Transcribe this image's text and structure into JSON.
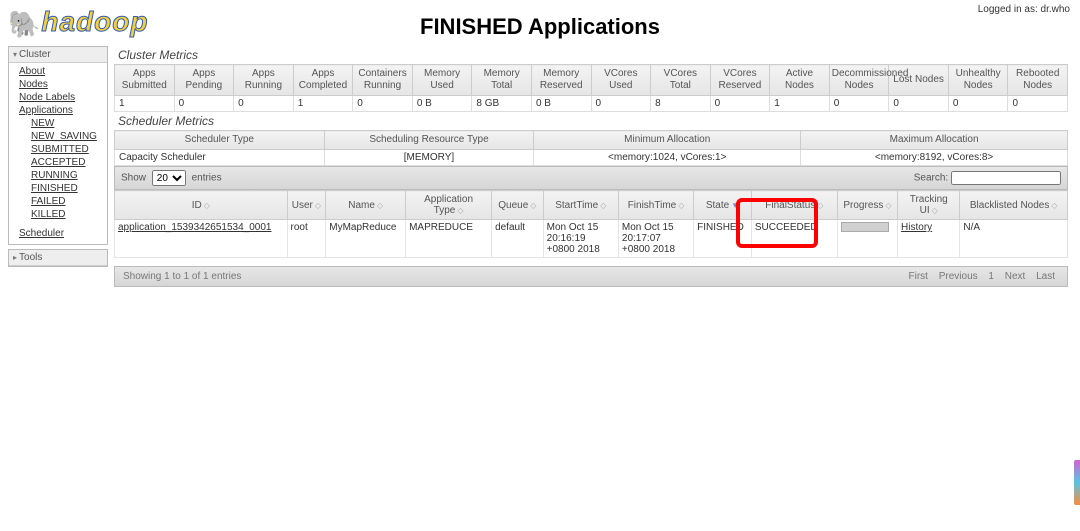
{
  "login_text": "Logged in as: dr.who",
  "page_title": "FINISHED Applications",
  "logo_text": "hadoop",
  "sidebar": {
    "cluster_title": "Cluster",
    "tools_title": "Tools",
    "links": {
      "about": "About",
      "nodes": "Nodes",
      "node_labels": "Node Labels",
      "applications": "Applications",
      "scheduler": "Scheduler"
    },
    "app_states": {
      "new": "NEW",
      "new_saving": "NEW_SAVING",
      "submitted": "SUBMITTED",
      "accepted": "ACCEPTED",
      "running": "RUNNING",
      "finished": "FINISHED",
      "failed": "FAILED",
      "killed": "KILLED"
    }
  },
  "cluster_metrics": {
    "title": "Cluster Metrics",
    "headers": {
      "apps_submitted": "Apps Submitted",
      "apps_pending": "Apps Pending",
      "apps_running": "Apps Running",
      "apps_completed": "Apps Completed",
      "containers_running": "Containers Running",
      "memory_used": "Memory Used",
      "memory_total": "Memory Total",
      "memory_reserved": "Memory Reserved",
      "vcores_used": "VCores Used",
      "vcores_total": "VCores Total",
      "vcores_reserved": "VCores Reserved",
      "active_nodes": "Active Nodes",
      "decommissioned_nodes": "Decommissioned Nodes",
      "lost_nodes": "Lost Nodes",
      "unhealthy_nodes": "Unhealthy Nodes",
      "rebooted_nodes": "Rebooted Nodes"
    },
    "values": {
      "apps_submitted": "1",
      "apps_pending": "0",
      "apps_running": "0",
      "apps_completed": "1",
      "containers_running": "0",
      "memory_used": "0 B",
      "memory_total": "8 GB",
      "memory_reserved": "0 B",
      "vcores_used": "0",
      "vcores_total": "8",
      "vcores_reserved": "0",
      "active_nodes": "1",
      "decommissioned_nodes": "0",
      "lost_nodes": "0",
      "unhealthy_nodes": "0",
      "rebooted_nodes": "0"
    }
  },
  "scheduler_metrics": {
    "title": "Scheduler Metrics",
    "headers": {
      "type": "Scheduler Type",
      "resource_type": "Scheduling Resource Type",
      "min_alloc": "Minimum Allocation",
      "max_alloc": "Maximum Allocation"
    },
    "values": {
      "type": "Capacity Scheduler",
      "resource_type": "[MEMORY]",
      "min_alloc": "<memory:1024, vCores:1>",
      "max_alloc": "<memory:8192, vCores:8>"
    }
  },
  "ctrlbar": {
    "show": "Show",
    "page_size": "20",
    "entries": "entries",
    "search_label": "Search:",
    "search_value": ""
  },
  "apps_table": {
    "headers": {
      "id": "ID",
      "user": "User",
      "name": "Name",
      "app_type": "Application Type",
      "queue": "Queue",
      "start": "StartTime",
      "finish": "FinishTime",
      "state": "State",
      "final_status": "FinalStatus",
      "progress": "Progress",
      "tracking": "Tracking UI",
      "blacklisted": "Blacklisted Nodes"
    },
    "row": {
      "id": "application_1539342651534_0001",
      "user": "root",
      "name": "MyMapReduce",
      "app_type": "MAPREDUCE",
      "queue": "default",
      "start": "Mon Oct 15 20:16:19 +0800 2018",
      "finish": "Mon Oct 15 20:17:07 +0800 2018",
      "state": "FINISHED",
      "final_status": "SUCCEEDED",
      "tracking": "History",
      "blacklisted": "N/A"
    }
  },
  "footer": {
    "info": "Showing 1 to 1 of 1 entries",
    "first": "First",
    "previous": "Previous",
    "page": "1",
    "next": "Next",
    "last": "Last"
  }
}
